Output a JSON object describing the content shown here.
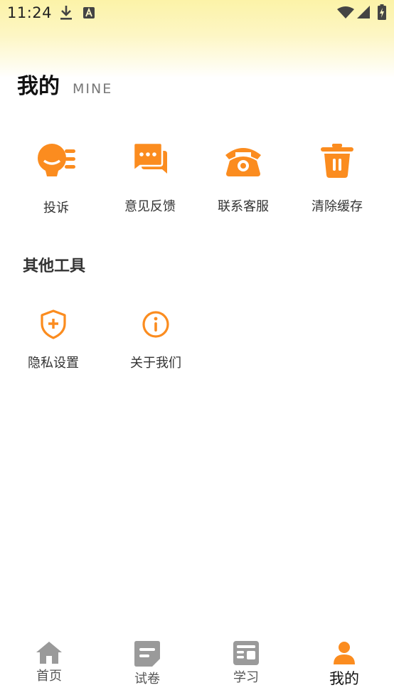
{
  "status_bar": {
    "time": "11:24",
    "icons": [
      "download-icon",
      "a-notification-icon",
      "wifi-icon",
      "signal-icon",
      "battery-charging-icon"
    ]
  },
  "header": {
    "title": "我的",
    "subtitle": "MINE"
  },
  "main_tools": [
    {
      "label": "投诉",
      "icon": "complaint-icon"
    },
    {
      "label": "意见反馈",
      "icon": "feedback-icon"
    },
    {
      "label": "联系客服",
      "icon": "phone-icon"
    },
    {
      "label": "清除缓存",
      "icon": "trash-icon"
    }
  ],
  "other_tools": {
    "title": "其他工具",
    "items": [
      {
        "label": "隐私设置",
        "icon": "shield-plus-icon"
      },
      {
        "label": "关于我们",
        "icon": "info-icon"
      }
    ]
  },
  "bottom_nav": {
    "active_index": 3,
    "items": [
      {
        "label": "首页",
        "icon": "home-icon"
      },
      {
        "label": "试卷",
        "icon": "paper-icon"
      },
      {
        "label": "学习",
        "icon": "study-icon"
      },
      {
        "label": "我的",
        "icon": "person-icon"
      }
    ]
  },
  "colors": {
    "accent": "#fb8c1f",
    "nav_inactive": "#9a9a9a",
    "header_gradient": "#fcf3a8"
  }
}
